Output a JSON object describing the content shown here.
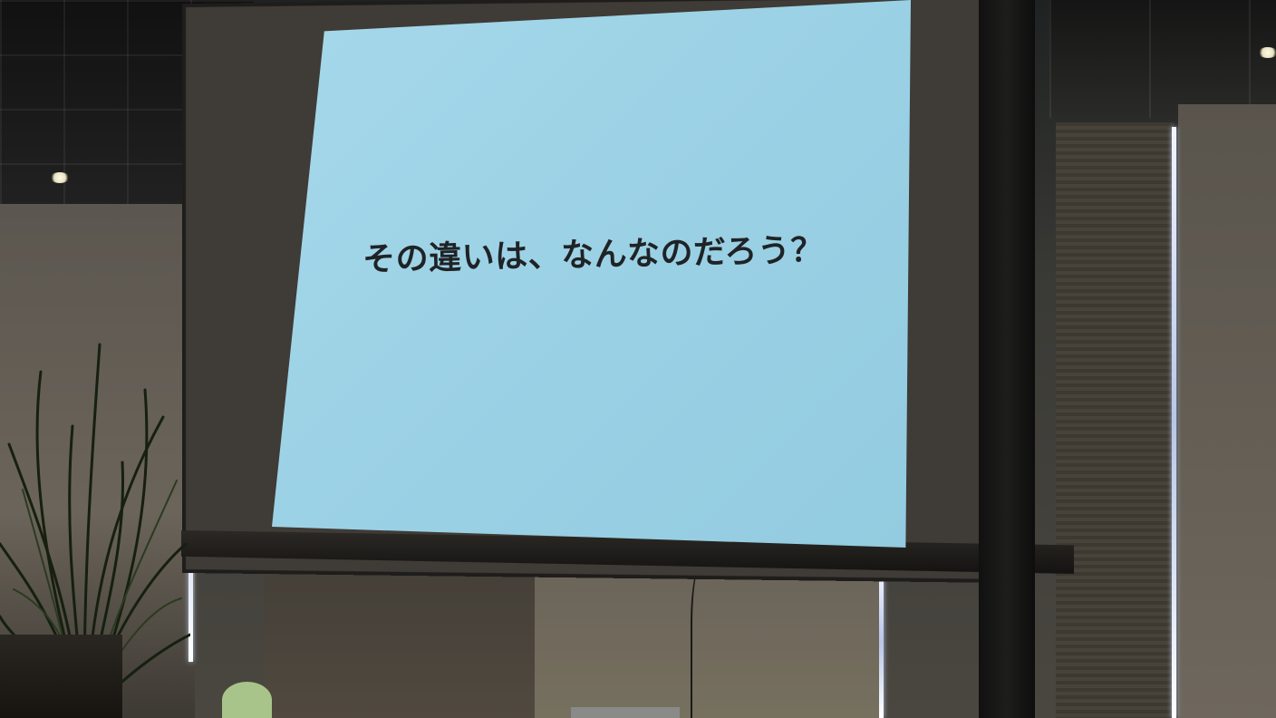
{
  "slide": {
    "text": "その違いは、なんなのだろう？",
    "background_color": "#9dd3e6",
    "text_color": "#1f2326"
  },
  "scene": {
    "wall_color": "#6b645a",
    "ceiling_color": "#1a1a1a",
    "plant_color": "#1b2418"
  }
}
